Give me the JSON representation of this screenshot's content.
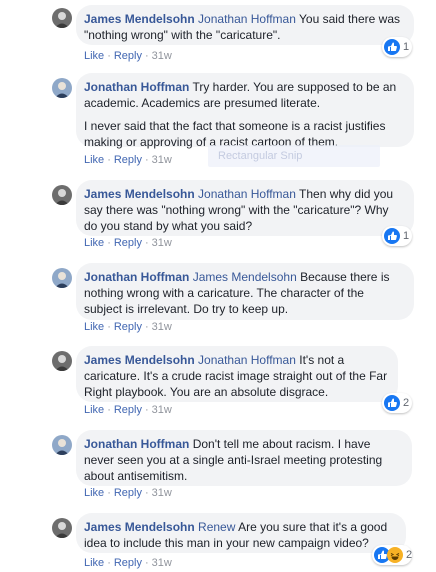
{
  "actions": {
    "like": "Like",
    "reply": "Reply",
    "separator": "·"
  },
  "comments": [
    {
      "author": "James Mendelsohn",
      "mention": "Jonathan Hoffman",
      "text": "You said there was \"nothing wrong\" with the \"caricature\".",
      "time": "31w",
      "reaction_count": "1"
    },
    {
      "author": "Jonathan Hoffman",
      "mention": "",
      "text": "Try harder. You are supposed to be an academic. Academics are presumed literate.",
      "text2": "I never said that the fact that someone is a racist justifies making or approving of a racist cartoon of them.",
      "time": "31w"
    },
    {
      "author": "James Mendelsohn",
      "mention": "Jonathan Hoffman",
      "text": "Then why did you say there was \"nothing wrong\" with the \"caricature\"? Why do you stand by what you said?",
      "time": "31w",
      "reaction_count": "1"
    },
    {
      "author": "Jonathan Hoffman",
      "mention": "James Mendelsohn",
      "text": "Because there is nothing wrong with a caricature. The character of the subject is irrelevant. Do try to keep up.",
      "time": "31w"
    },
    {
      "author": "James Mendelsohn",
      "mention": "Jonathan Hoffman",
      "text": "It's not a caricature. It's a crude racist image straight out of the Far Right playbook. You are an absolute disgrace.",
      "time": "31w",
      "reaction_count": "2"
    },
    {
      "author": "Jonathan Hoffman",
      "mention": "",
      "text": "Don't tell me about racism. I have never seen you at a single anti-Israel meeting protesting about antisemitism.",
      "time": "31w"
    },
    {
      "author": "James Mendelsohn",
      "mention": "Renew",
      "text": "Are you sure that it's a good idea to include this man in your new campaign video?",
      "time": "31w",
      "reaction_count": "2"
    }
  ],
  "overlay_text": "Rectangular Snip",
  "colors": {
    "author": "#385898",
    "bubble": "#f2f3f5",
    "like_blue": "#1877f2",
    "haha_yellow": "#f7b125"
  }
}
